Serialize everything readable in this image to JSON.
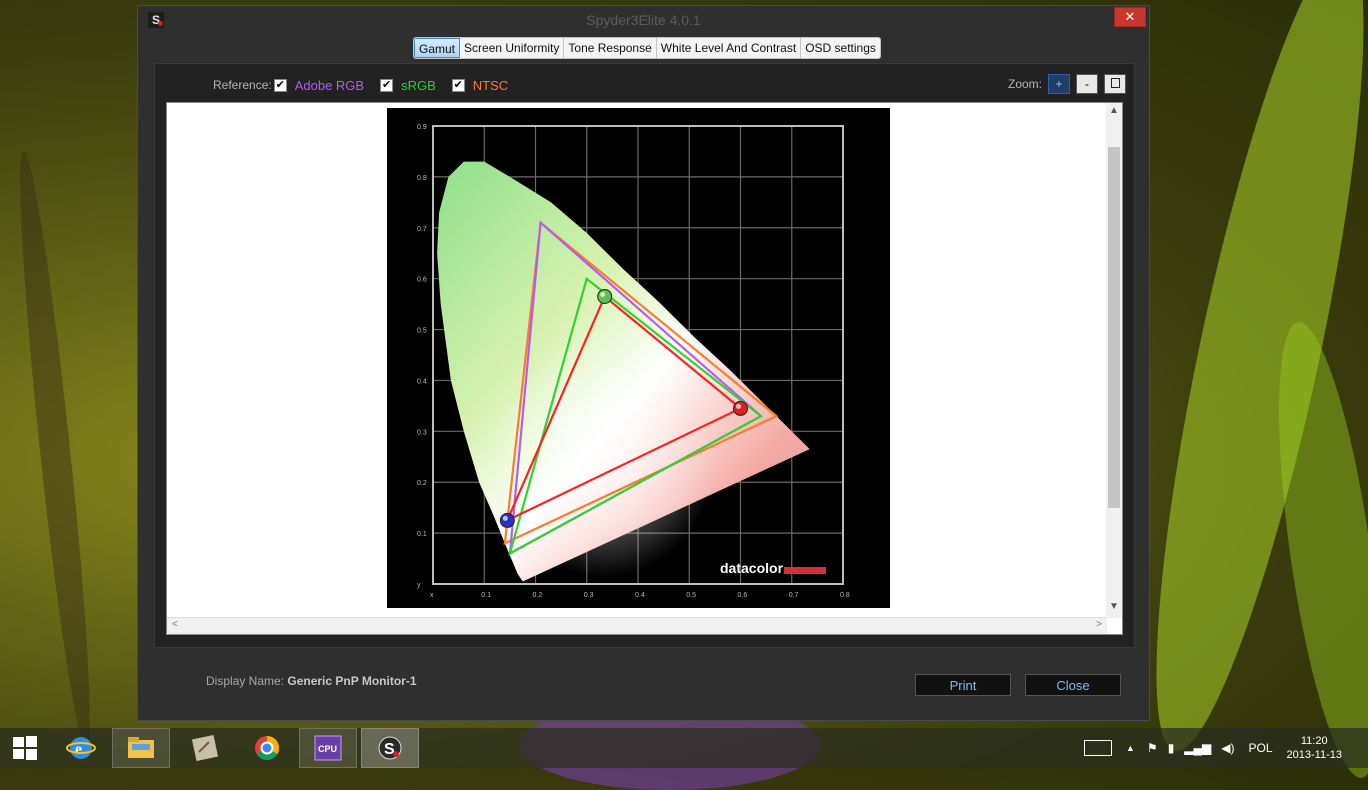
{
  "window": {
    "title": "Spyder3Elite 4.0.1",
    "close_glyph": "✕",
    "icon_letter": "S"
  },
  "tabs": [
    {
      "label": "Gamut",
      "active": true
    },
    {
      "label": "Screen Uniformity",
      "active": false
    },
    {
      "label": "Tone Response",
      "active": false
    },
    {
      "label": "White Level And Contrast",
      "active": false
    },
    {
      "label": "OSD settings",
      "active": false
    }
  ],
  "reference": {
    "label": "Reference:",
    "items": [
      {
        "label": "Adobe RGB",
        "checked": true,
        "color": "#b65cf0"
      },
      {
        "label": "sRGB",
        "checked": true,
        "color": "#2fd22f"
      },
      {
        "label": "NTSC",
        "checked": true,
        "color": "#ff7a2a"
      }
    ]
  },
  "zoom": {
    "label": "Zoom:",
    "plus": "+",
    "minus": "-"
  },
  "chart_data": {
    "type": "line",
    "xlim": [
      0,
      0.8
    ],
    "ylim": [
      0,
      0.9
    ],
    "x_ticks": [
      "x",
      "0.1",
      "0.2",
      "0.3",
      "0.4",
      "0.5",
      "0.6",
      "0.7",
      "0.8"
    ],
    "y_ticks": [
      "y",
      "0.1",
      "0.2",
      "0.3",
      "0.4",
      "0.5",
      "0.6",
      "0.7",
      "0.8",
      "0.9"
    ],
    "logo": "datacolor",
    "series": [
      {
        "name": "NTSC",
        "color": "#ff7a2a",
        "points": [
          [
            0.67,
            0.33
          ],
          [
            0.21,
            0.71
          ],
          [
            0.14,
            0.08
          ]
        ]
      },
      {
        "name": "Adobe RGB",
        "color": "#b65cf0",
        "points": [
          [
            0.64,
            0.33
          ],
          [
            0.21,
            0.71
          ],
          [
            0.15,
            0.06
          ]
        ]
      },
      {
        "name": "sRGB",
        "color": "#2fd22f",
        "points": [
          [
            0.64,
            0.33
          ],
          [
            0.3,
            0.6
          ],
          [
            0.15,
            0.06
          ]
        ]
      },
      {
        "color": "#ff2020",
        "points": [
          [
            0.6,
            0.345
          ],
          [
            0.335,
            0.565
          ],
          [
            0.145,
            0.125
          ]
        ]
      }
    ]
  },
  "footer": {
    "display_label": "Display Name:",
    "display_value": "Generic PnP Monitor-1",
    "print": "Print",
    "close": "Close"
  },
  "taskbar": {
    "language": "POL",
    "time": "11:20",
    "date": "2013-11-13"
  }
}
